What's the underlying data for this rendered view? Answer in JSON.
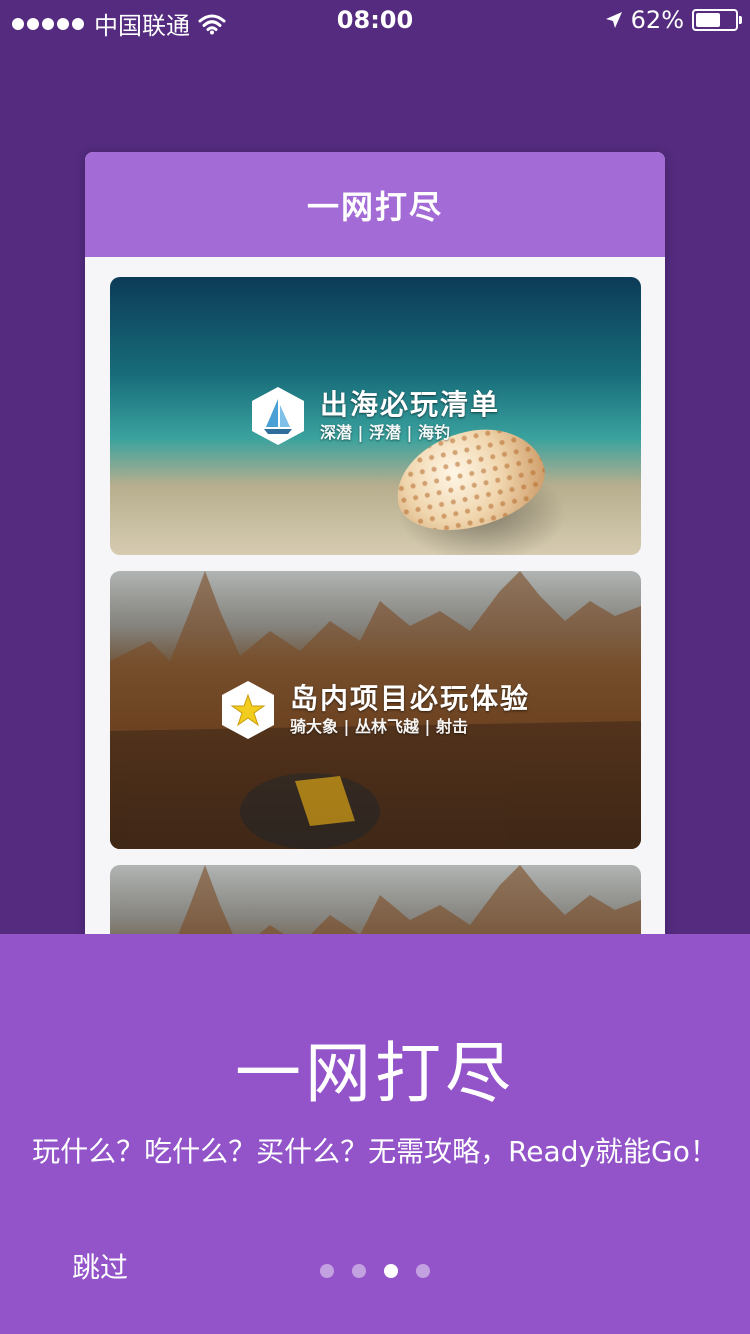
{
  "status_bar": {
    "carrier": "中国联通",
    "time": "08:00",
    "battery_percent": "62%",
    "battery_level": 0.62,
    "signal_dots": 5,
    "icons": [
      "signal-dots-icon",
      "wifi-icon",
      "location-arrow-icon",
      "battery-icon"
    ]
  },
  "preview": {
    "header_title": "一网打尽",
    "cards": [
      {
        "title": "出海必玩清单",
        "subtitle": "深潜 | 浮潜 | 海钓",
        "icon": "sailboat-icon"
      },
      {
        "title": "岛内项目必玩体验",
        "subtitle": "骑大象 | 丛林飞越 | 射击",
        "icon": "star-icon"
      }
    ]
  },
  "onboarding": {
    "title": "一网打尽",
    "subtitle": "玩什么？吃什么？买什么？无需攻略，Ready就能Go！",
    "skip_label": "跳过",
    "page_count": 4,
    "current_page": 3
  },
  "colors": {
    "background": "#542b7f",
    "preview_header": "#a36bd6",
    "bottom_sheet": "#9254c8",
    "text": "#ffffff"
  }
}
